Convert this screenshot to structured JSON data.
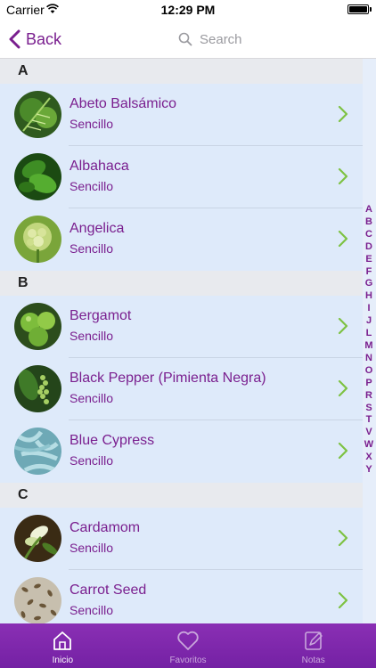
{
  "status": {
    "carrier": "Carrier",
    "time": "12:29 PM",
    "battery_level": 1.0
  },
  "nav": {
    "back_label": "Back",
    "search_placeholder": "Search"
  },
  "sections": [
    {
      "letter": "A",
      "items": [
        {
          "title": "Abeto Balsámico",
          "subtitle": "Sencillo",
          "image": "fir-branch"
        },
        {
          "title": "Albahaca",
          "subtitle": "Sencillo",
          "image": "basil-leaves"
        },
        {
          "title": "Angelica",
          "subtitle": "Sencillo",
          "image": "angelica-flower"
        }
      ]
    },
    {
      "letter": "B",
      "items": [
        {
          "title": "Bergamot",
          "subtitle": "Sencillo",
          "image": "bergamot-fruit"
        },
        {
          "title": "Black Pepper (Pimienta Negra)",
          "subtitle": "Sencillo",
          "image": "pepper-berries"
        },
        {
          "title": "Blue Cypress",
          "subtitle": "Sencillo",
          "image": "cypress-foliage"
        }
      ]
    },
    {
      "letter": "C",
      "items": [
        {
          "title": "Cardamom",
          "subtitle": "Sencillo",
          "image": "cardamom-plant"
        },
        {
          "title": "Carrot Seed",
          "subtitle": "Sencillo",
          "image": "carrot-seeds"
        }
      ]
    }
  ],
  "index_letters": [
    "A",
    "B",
    "C",
    "D",
    "E",
    "F",
    "G",
    "H",
    "I",
    "J",
    "L",
    "M",
    "N",
    "O",
    "P",
    "R",
    "S",
    "T",
    "V",
    "W",
    "X",
    "Y"
  ],
  "tabs": [
    {
      "label": "Inicio",
      "icon": "home-icon",
      "active": true
    },
    {
      "label": "Favoritos",
      "icon": "heart-icon",
      "active": false
    },
    {
      "label": "Notas",
      "icon": "notes-icon",
      "active": false
    }
  ],
  "colors": {
    "accent": "#7a1f8f",
    "tab_bar": "#7e27ab",
    "row_bg": "#deeafa",
    "chevron": "#7dc242"
  }
}
